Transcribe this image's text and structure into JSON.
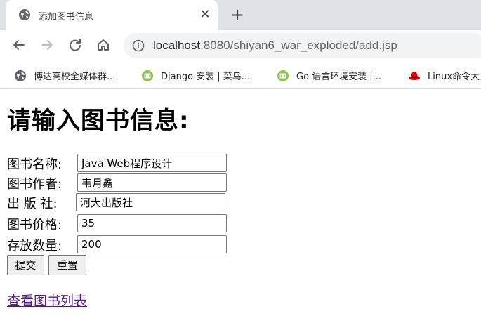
{
  "browser": {
    "tab": {
      "title": "添加图书信息",
      "close_glyph": "✕",
      "favicon": "globe-icon"
    },
    "new_tab_glyph": "+",
    "omnibox": {
      "host": "localhost",
      "rest": ":8080/shiyan6_war_exploded/add.jsp"
    },
    "bookmarks": [
      {
        "label": "博达高校全媒体群...",
        "icon": "globe-icon"
      },
      {
        "label": "Django 安装 | 菜鸟...",
        "icon": "runoob-icon"
      },
      {
        "label": "Go 语言环境安装 |...",
        "icon": "runoob-icon"
      },
      {
        "label": "Linux命令大",
        "icon": "redhat-icon"
      }
    ]
  },
  "page": {
    "heading": "请输入图书信息:",
    "fields": [
      {
        "label": "图书名称:",
        "value": "Java Web程序设计"
      },
      {
        "label": "图书作者:",
        "value": "韦月鑫"
      },
      {
        "label": "出 版 社:",
        "value": "河大出版社"
      },
      {
        "label": "图书价格:",
        "value": "35"
      },
      {
        "label": "存放数量:",
        "value": "200"
      }
    ],
    "submit_label": "提交",
    "reset_label": "重置",
    "list_link": "查看图书列表"
  },
  "colors": {
    "tabstrip_bg": "#dee1e6",
    "omnibox_bg": "#f1f3f4",
    "visited_link": "#551a8b",
    "runoob_green": "#8bc34a",
    "redhat_red": "#e00000"
  }
}
